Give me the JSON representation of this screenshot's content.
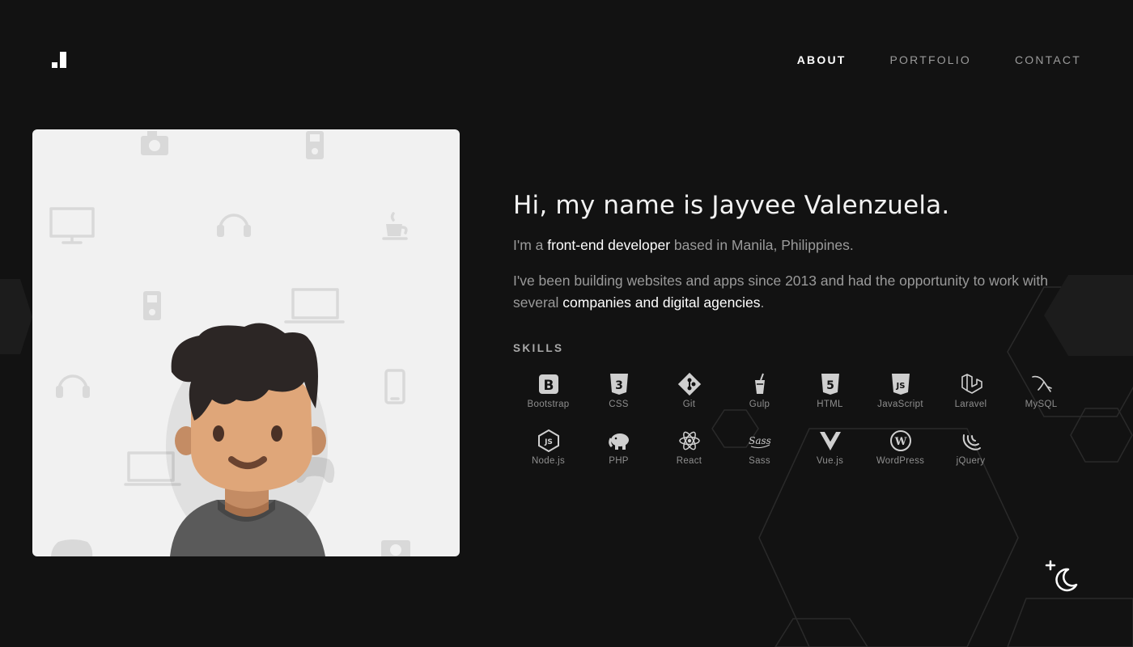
{
  "header": {
    "nav": [
      {
        "label": "ABOUT",
        "active": true
      },
      {
        "label": "PORTFOLIO",
        "active": false
      },
      {
        "label": "CONTACT",
        "active": false
      }
    ]
  },
  "intro": {
    "heading": "Hi, my name is Jayvee Valenzuela.",
    "line1": {
      "before": "I'm a ",
      "highlight": "front-end developer",
      "after": " based in Manila, Philippines."
    },
    "line2": {
      "before": "I've been building websites and apps since 2013 and had the opportunity to work with several ",
      "highlight": "companies and digital agencies",
      "after": "."
    }
  },
  "skills": {
    "label": "SKILLS",
    "items": [
      {
        "label": "Bootstrap",
        "icon": "bootstrap-icon"
      },
      {
        "label": "CSS",
        "icon": "css3-icon"
      },
      {
        "label": "Git",
        "icon": "git-icon"
      },
      {
        "label": "Gulp",
        "icon": "gulp-icon"
      },
      {
        "label": "HTML",
        "icon": "html5-icon"
      },
      {
        "label": "JavaScript",
        "icon": "javascript-icon"
      },
      {
        "label": "Laravel",
        "icon": "laravel-icon"
      },
      {
        "label": "MySQL",
        "icon": "mysql-icon"
      },
      {
        "label": "Node.js",
        "icon": "nodejs-icon"
      },
      {
        "label": "PHP",
        "icon": "php-elephant-icon"
      },
      {
        "label": "React",
        "icon": "react-icon"
      },
      {
        "label": "Sass",
        "icon": "sass-icon"
      },
      {
        "label": "Vue.js",
        "icon": "vuejs-icon"
      },
      {
        "label": "WordPress",
        "icon": "wordpress-icon"
      },
      {
        "label": "jQuery",
        "icon": "jquery-icon"
      }
    ]
  },
  "colors": {
    "background": "#121212",
    "text": "#9a9a9a",
    "highlight": "#ffffff",
    "card": "#f1f1f1"
  }
}
